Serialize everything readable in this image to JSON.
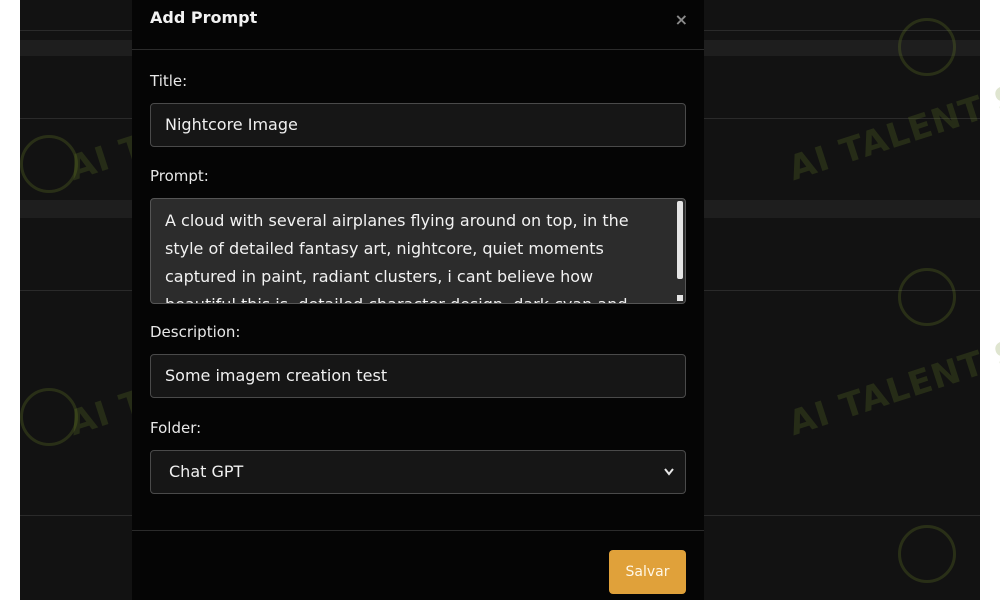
{
  "modal": {
    "title": "Add Prompt",
    "close_icon": "×"
  },
  "form": {
    "title_label": "Title:",
    "title_value": "Nightcore Image",
    "prompt_label": "Prompt:",
    "prompt_value": "A cloud with several airplanes flying around on top, in the style of detailed fantasy art, nightcore, quiet moments captured in paint, radiant clusters, i cant believe how beautiful this is, detailed character design, dark cyan and light crimson",
    "description_label": "Description:",
    "description_value": "Some imagem creation test",
    "folder_label": "Folder:",
    "folder_selected": "Chat GPT",
    "chevron_icon": "chevron-down-icon"
  },
  "footer": {
    "save_label": "Salvar"
  },
  "watermark": {
    "text": "AI TALENT SPACE",
    "logo_icon": "brain-logo-icon"
  },
  "colors": {
    "accent": "#e0a13a",
    "modal_bg": "#050505",
    "watermark": "#6e8728"
  }
}
